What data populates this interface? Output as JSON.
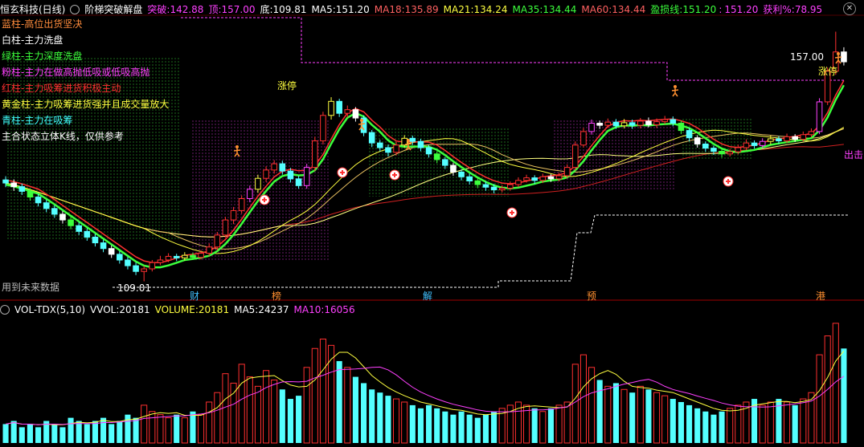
{
  "header": {
    "stock": "恒玄科技(日线)",
    "indicator": "阶梯突破解盘",
    "tupo_label": "突破:",
    "tupo_value": "142.88",
    "ding_label": "顶:",
    "ding_value": "157.00",
    "di_label": "底:",
    "di_value": "109.81",
    "ma5_label": "MA5:",
    "ma5_value": "151.20",
    "ma18_label": "MA18:",
    "ma18_value": "135.89",
    "ma21_label": "MA21:",
    "ma21_value": "134.24",
    "ma35_label": "MA35:",
    "ma35_value": "134.44",
    "ma60_label": "MA60:",
    "ma60_value": "134.44",
    "ykx_label": "盈损线:",
    "ykx_value1": "151.20",
    "ykx_value2": "151.20",
    "hl_label": "获利%:",
    "hl_value": "78.95"
  },
  "legend": [
    {
      "text": "蓝柱-高位出货坚决",
      "color": "#ff8c3c"
    },
    {
      "text": "白柱-主力洗盘",
      "color": "#ffffff"
    },
    {
      "text": "绿柱-主力深度洗盘",
      "color": "#3cff3c"
    },
    {
      "text": "粉柱-主力在做高抛低吸或低吸高抛",
      "color": "#ff40ff"
    },
    {
      "text": "红柱-主力吸筹进货积极主动",
      "color": "#ff3030"
    },
    {
      "text": "黄金柱-主力吸筹进货强并且成交量放大",
      "color": "#ffff40"
    },
    {
      "text": "青柱-主力在吸筹",
      "color": "#40ffff"
    },
    {
      "text": "主合状态立体K线，仅供参考",
      "color": "#ffffff"
    }
  ],
  "annotations": {
    "zhangting1": "涨停",
    "zhangting2": "涨停",
    "peak_price": "157.00",
    "low_price": "109.01",
    "future_data": "用到未来数据",
    "chu": "出击",
    "markers": [
      "财",
      "榜",
      "解",
      "预",
      "港"
    ]
  },
  "sub": {
    "title": "VOL-TDX(5,10)",
    "vvol_label": "VVOL:",
    "vvol_value": "20181",
    "volume_label": "VOLUME:",
    "volume_value": "20181",
    "ma5_label": "MA5:",
    "ma5_value": "24237",
    "ma10_label": "MA10:",
    "ma10_value": "16056"
  },
  "colors": {
    "up": "#ff3030",
    "down": "#54ffff",
    "ma5": "#ffffff",
    "ma_yellow": "#ffff40",
    "ma_red": "#ff3030",
    "ma_green": "#3cff3c",
    "magenta": "#ff40ff",
    "cyan": "#40ffff"
  },
  "chart_data": {
    "type": "candlestick",
    "price_range": [
      109.01,
      157.0
    ],
    "candles": [
      [
        128.5,
        127.9,
        129.2,
        127.1
      ],
      [
        127.9,
        127.2,
        128.6,
        126.4
      ],
      [
        127.2,
        126.3,
        127.8,
        125.6
      ],
      [
        126.3,
        125.2,
        126.9,
        124.5
      ],
      [
        125.2,
        124.1,
        125.8,
        123.4
      ],
      [
        124.1,
        123.0,
        124.7,
        122.3
      ],
      [
        123.0,
        121.9,
        123.6,
        121.2
      ],
      [
        121.9,
        120.8,
        122.5,
        120.1
      ],
      [
        120.8,
        119.7,
        121.4,
        119.0
      ],
      [
        119.7,
        118.6,
        120.3,
        117.9
      ],
      [
        118.6,
        117.5,
        119.2,
        116.8
      ],
      [
        117.5,
        116.4,
        118.1,
        115.7
      ],
      [
        116.4,
        115.3,
        117.0,
        114.6
      ],
      [
        115.3,
        114.2,
        115.9,
        113.5
      ],
      [
        114.2,
        113.1,
        114.8,
        112.4
      ],
      [
        113.1,
        112.0,
        113.7,
        111.3
      ],
      [
        112.0,
        110.9,
        112.6,
        110.2
      ],
      [
        110.9,
        111.4,
        112.0,
        109.0
      ],
      [
        111.4,
        112.6,
        113.1,
        110.9
      ],
      [
        112.6,
        113.1,
        113.9,
        112.1
      ],
      [
        113.1,
        113.8,
        114.4,
        112.7
      ],
      [
        113.8,
        113.5,
        114.3,
        112.9
      ],
      [
        113.5,
        114.0,
        114.6,
        113.0
      ],
      [
        114.0,
        113.6,
        114.5,
        113.1
      ],
      [
        113.6,
        114.4,
        115.0,
        113.2
      ],
      [
        114.4,
        115.6,
        116.3,
        113.8
      ],
      [
        115.6,
        117.9,
        118.5,
        115.0
      ],
      [
        117.9,
        120.8,
        121.4,
        117.4
      ],
      [
        120.8,
        122.6,
        123.3,
        120.0
      ],
      [
        122.6,
        124.9,
        125.5,
        122.0
      ],
      [
        124.9,
        126.7,
        127.4,
        124.2
      ],
      [
        126.7,
        128.8,
        129.5,
        126.0
      ],
      [
        128.8,
        130.4,
        131.1,
        128.1
      ],
      [
        130.4,
        131.6,
        132.3,
        129.7
      ],
      [
        131.6,
        130.2,
        132.2,
        129.5
      ],
      [
        130.2,
        128.7,
        130.8,
        128.0
      ],
      [
        128.7,
        127.4,
        129.3,
        126.8
      ],
      [
        127.4,
        130.9,
        131.6,
        126.8
      ],
      [
        130.9,
        136.0,
        136.8,
        130.2
      ],
      [
        136.0,
        140.9,
        141.6,
        135.3
      ],
      [
        140.9,
        143.6,
        144.4,
        140.1
      ],
      [
        143.6,
        141.3,
        144.1,
        140.6
      ],
      [
        141.3,
        142.0,
        142.8,
        140.5
      ],
      [
        142.0,
        140.4,
        142.5,
        139.7
      ],
      [
        140.4,
        137.6,
        140.9,
        136.9
      ],
      [
        137.6,
        135.6,
        138.1,
        134.8
      ],
      [
        135.6,
        134.7,
        136.2,
        134.0
      ],
      [
        134.7,
        133.8,
        135.3,
        133.0
      ],
      [
        133.8,
        135.2,
        135.8,
        133.2
      ],
      [
        135.2,
        136.5,
        137.1,
        134.7
      ],
      [
        136.5,
        135.9,
        137.0,
        135.2
      ],
      [
        135.9,
        134.7,
        136.4,
        134.0
      ],
      [
        134.7,
        133.5,
        135.2,
        132.8
      ],
      [
        133.5,
        132.4,
        134.0,
        131.7
      ],
      [
        132.4,
        131.3,
        132.9,
        130.6
      ],
      [
        131.3,
        130.0,
        131.8,
        129.3
      ],
      [
        130.0,
        129.1,
        130.6,
        128.4
      ],
      [
        129.1,
        128.3,
        129.7,
        127.6
      ],
      [
        128.3,
        127.6,
        128.9,
        126.9
      ],
      [
        127.6,
        127.1,
        128.2,
        126.4
      ],
      [
        127.1,
        126.6,
        127.7,
        125.9
      ],
      [
        126.6,
        126.9,
        127.5,
        126.1
      ],
      [
        126.9,
        127.6,
        128.2,
        126.4
      ],
      [
        127.6,
        128.4,
        129.0,
        127.1
      ],
      [
        128.4,
        128.9,
        129.5,
        128.0
      ],
      [
        128.9,
        128.4,
        129.4,
        127.7
      ],
      [
        128.4,
        129.1,
        129.7,
        127.9
      ],
      [
        129.1,
        128.7,
        129.6,
        128.1
      ],
      [
        128.7,
        129.3,
        129.9,
        128.2
      ],
      [
        129.3,
        130.9,
        131.5,
        128.8
      ],
      [
        130.9,
        135.2,
        135.9,
        130.3
      ],
      [
        135.2,
        137.8,
        138.5,
        134.7
      ],
      [
        137.8,
        139.4,
        140.1,
        137.2
      ],
      [
        139.4,
        139.0,
        139.9,
        138.3
      ],
      [
        139.0,
        139.6,
        140.3,
        138.5
      ],
      [
        139.6,
        138.9,
        140.2,
        138.3
      ],
      [
        138.9,
        139.5,
        140.2,
        138.4
      ],
      [
        139.5,
        139.0,
        140.1,
        138.3
      ],
      [
        139.0,
        139.8,
        140.4,
        138.4
      ],
      [
        139.8,
        139.1,
        140.5,
        138.6
      ],
      [
        139.1,
        139.7,
        140.3,
        138.5
      ],
      [
        139.7,
        140.1,
        140.8,
        139.2
      ],
      [
        140.1,
        139.4,
        140.7,
        138.8
      ],
      [
        139.4,
        138.0,
        139.9,
        137.3
      ],
      [
        138.0,
        136.6,
        138.5,
        135.9
      ],
      [
        136.6,
        135.4,
        137.1,
        134.7
      ],
      [
        135.4,
        134.6,
        135.9,
        133.9
      ],
      [
        134.6,
        134.0,
        135.1,
        133.3
      ],
      [
        134.0,
        133.5,
        134.6,
        132.8
      ],
      [
        133.5,
        133.9,
        134.5,
        133.0
      ],
      [
        133.9,
        134.7,
        135.3,
        133.4
      ],
      [
        134.7,
        135.6,
        136.3,
        134.2
      ],
      [
        135.6,
        135.1,
        136.1,
        134.5
      ],
      [
        135.1,
        135.9,
        136.5,
        134.6
      ],
      [
        135.9,
        136.4,
        137.0,
        135.3
      ],
      [
        136.4,
        136.0,
        136.9,
        135.4
      ],
      [
        136.0,
        136.8,
        137.4,
        135.6
      ],
      [
        136.8,
        136.3,
        137.3,
        135.8
      ],
      [
        136.3,
        137.2,
        137.8,
        135.9
      ],
      [
        137.2,
        137.8,
        138.4,
        136.7
      ],
      [
        137.8,
        143.5,
        144.2,
        137.3
      ],
      [
        143.5,
        149.4,
        150.1,
        142.9
      ],
      [
        149.4,
        153.1,
        157.0,
        148.7
      ],
      [
        153.1,
        151.2,
        154.0,
        150.5
      ]
    ],
    "volume": [
      6,
      7,
      5,
      6,
      5,
      7,
      6,
      5,
      8,
      7,
      6,
      7,
      8,
      6,
      7,
      9,
      8,
      12,
      10,
      9,
      8,
      9,
      8,
      10,
      9,
      13,
      16,
      22,
      19,
      25,
      21,
      18,
      23,
      20,
      17,
      14,
      15,
      24,
      30,
      33,
      31,
      26,
      24,
      21,
      19,
      17,
      16,
      15,
      14,
      13,
      12,
      11,
      12,
      11,
      10,
      9,
      10,
      9,
      8,
      9,
      10,
      11,
      12,
      13,
      12,
      11,
      10,
      11,
      12,
      13,
      25,
      28,
      24,
      20,
      18,
      19,
      17,
      16,
      18,
      17,
      16,
      15,
      14,
      13,
      12,
      11,
      10,
      9,
      10,
      11,
      12,
      13,
      14,
      12,
      13,
      14,
      13,
      12,
      14,
      16,
      28,
      34,
      38,
      30
    ],
    "vol_max": 40
  }
}
